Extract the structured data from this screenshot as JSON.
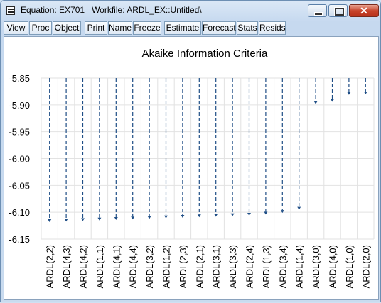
{
  "window": {
    "title": "Equation: EX701   Workfile: ARDL_EX::Untitled\\",
    "minimize_icon": "minimize-icon",
    "maximize_icon": "maximize-icon",
    "close_icon": "close-icon",
    "close_label": "✕"
  },
  "toolbar": {
    "buttons": [
      {
        "label": "View"
      },
      {
        "label": "Proc"
      },
      {
        "label": "Object"
      },
      {
        "label": "Print"
      },
      {
        "label": "Name"
      },
      {
        "label": "Freeze"
      },
      {
        "label": "Estimate"
      },
      {
        "label": "Forecast"
      },
      {
        "label": "Stats"
      },
      {
        "label": "Resids"
      }
    ]
  },
  "colors": {
    "series": "#1f4e86",
    "grid": "#e2e2e2"
  },
  "chart_data": {
    "type": "dot",
    "title": "Akaike Information Criteria",
    "xlabel": "",
    "ylabel": "",
    "ylim": [
      -6.15,
      -5.85
    ],
    "y_ticks": [
      "-5.85",
      "-5.90",
      "-5.95",
      "-6.00",
      "-6.05",
      "-6.10",
      "-6.15"
    ],
    "grid": true,
    "categories": [
      "ARDL(2,2)",
      "ARDL(4,3)",
      "ARDL(4,2)",
      "ARDL(1,1)",
      "ARDL(4,1)",
      "ARDL(4,4)",
      "ARDL(3,2)",
      "ARDL(1,2)",
      "ARDL(2,3)",
      "ARDL(2,1)",
      "ARDL(3,1)",
      "ARDL(3,3)",
      "ARDL(2,4)",
      "ARDL(1,3)",
      "ARDL(3,4)",
      "ARDL(1,4)",
      "ARDL(3,0)",
      "ARDL(4,0)",
      "ARDL(1,0)",
      "ARDL(2,0)"
    ],
    "values": [
      -6.117,
      -6.116,
      -6.115,
      -6.114,
      -6.113,
      -6.112,
      -6.111,
      -6.11,
      -6.109,
      -6.108,
      -6.107,
      -6.106,
      -6.105,
      -6.103,
      -6.1,
      -6.094,
      -5.897,
      -5.893,
      -5.88,
      -5.879
    ]
  }
}
